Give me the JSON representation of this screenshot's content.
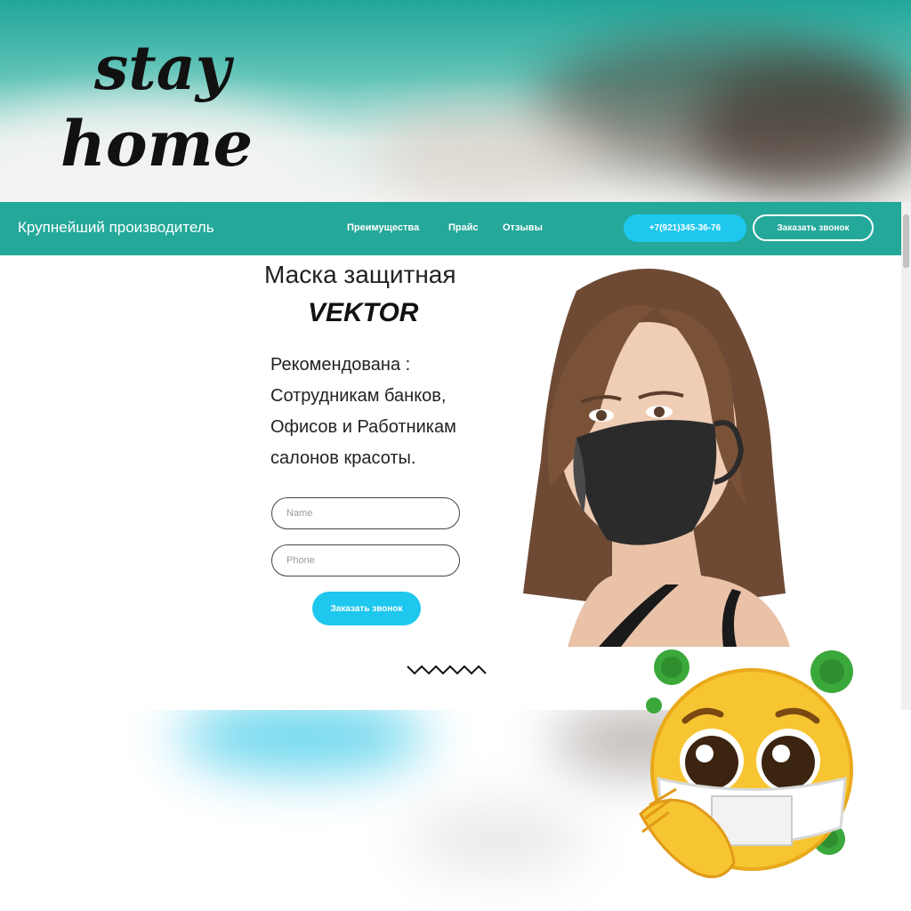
{
  "overlay": {
    "stay": "stay",
    "home": "home"
  },
  "navbar": {
    "brand": "Крупнейший производитель",
    "links": [
      "Преимущества",
      "Прайс",
      "Отзывы"
    ],
    "phone": "+7(921)345-36-76",
    "call_button": "Заказать звонок"
  },
  "hero": {
    "title": "Маска защитная",
    "brand": "VEKTOR",
    "description": [
      "Рекомендована :",
      "Сотрудникам банков,",
      "Офисов и Работникам",
      "салонов красоты."
    ]
  },
  "form": {
    "name_placeholder": "Name",
    "phone_placeholder": "Phone",
    "submit_label": "Заказать звонок"
  },
  "colors": {
    "accent_teal": "#24a89a",
    "button_cyan": "#1ec7ee",
    "text_dark": "#222222"
  },
  "icons": [
    "pleading-face-mask-emoji",
    "virus-icon",
    "clapping-hands-emoji",
    "zigzag-divider"
  ]
}
